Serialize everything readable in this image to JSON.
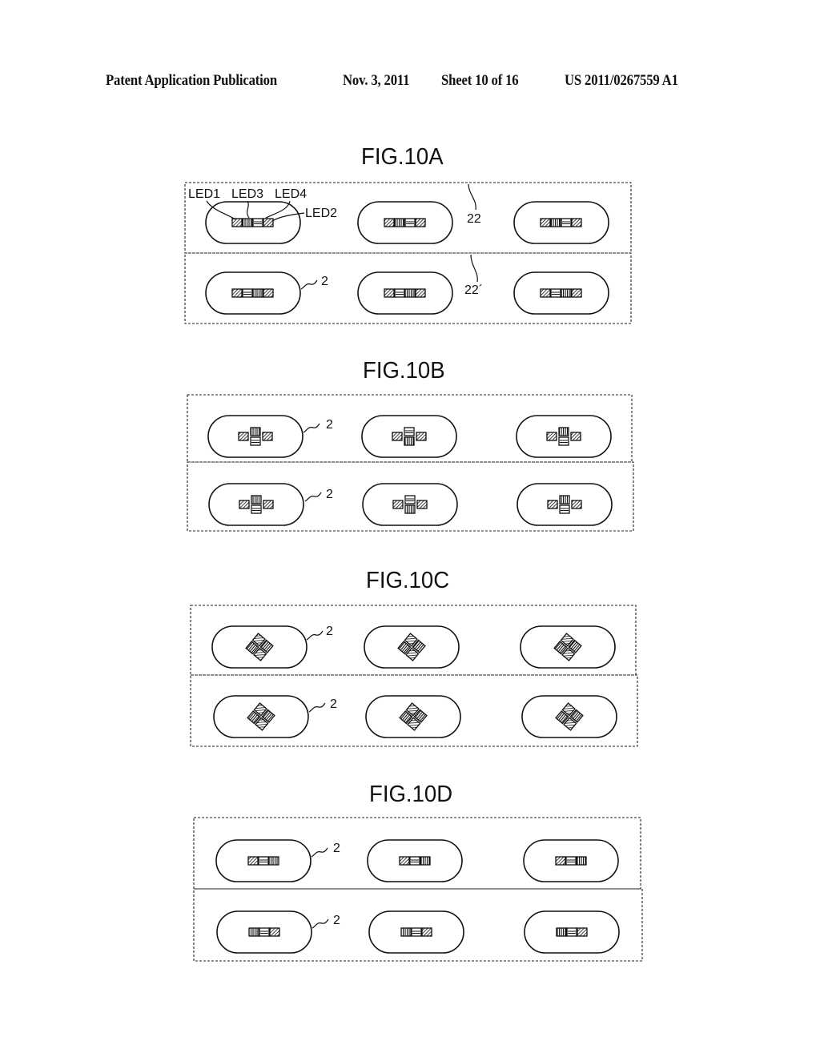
{
  "header": {
    "publication": "Patent Application Publication",
    "date": "Nov. 3, 2011",
    "sheet": "Sheet 10 of 16",
    "number": "US 2011/0267559 A1"
  },
  "figures": [
    {
      "id": "10A",
      "title": "FIG.10A",
      "arrangement": "linear",
      "rows": [
        {
          "ref": "22",
          "led_order": [
            "LED1",
            "LED3",
            "LED4",
            "LED2"
          ]
        },
        {
          "ref": "22´",
          "led_order": [
            "LED1",
            "LED4",
            "LED3",
            "LED2"
          ]
        }
      ],
      "callouts": [
        "LED1",
        "LED3",
        "LED4",
        "LED2",
        "22",
        "22´",
        "2"
      ]
    },
    {
      "id": "10B",
      "title": "FIG.10B",
      "arrangement": "cross",
      "rows": [
        {
          "ref": "2"
        },
        {
          "ref": "2"
        }
      ]
    },
    {
      "id": "10C",
      "title": "FIG.10C",
      "arrangement": "rotated-cluster",
      "rows": [
        {
          "ref": "2"
        },
        {
          "ref": "2"
        }
      ]
    },
    {
      "id": "10D",
      "title": "FIG.10D",
      "arrangement": "three-linear",
      "rows": [
        {
          "ref": "2",
          "led_order": [
            "diag",
            "horiz",
            "vert"
          ]
        },
        {
          "ref": "2",
          "led_order": [
            "vert",
            "horiz",
            "diag"
          ]
        }
      ]
    }
  ],
  "labels": {
    "led1": "LED1",
    "led2": "LED2",
    "led3": "LED3",
    "led4": "LED4",
    "ref22": "22",
    "ref22p": "22´",
    "ref2": "2"
  }
}
